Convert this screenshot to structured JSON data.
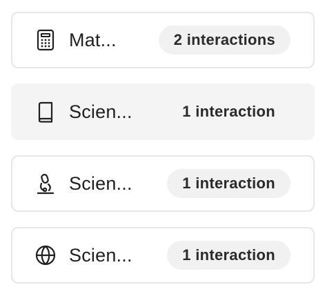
{
  "items": [
    {
      "icon": "calculator-icon",
      "label": "Mat...",
      "count_label": "2 interactions"
    },
    {
      "icon": "book-icon",
      "label": "Scien...",
      "count_label": "1 interaction",
      "selected": true
    },
    {
      "icon": "microscope-icon",
      "label": "Scien...",
      "count_label": "1 interaction"
    },
    {
      "icon": "globe-icon",
      "label": "Scien...",
      "count_label": "1 interaction"
    }
  ]
}
